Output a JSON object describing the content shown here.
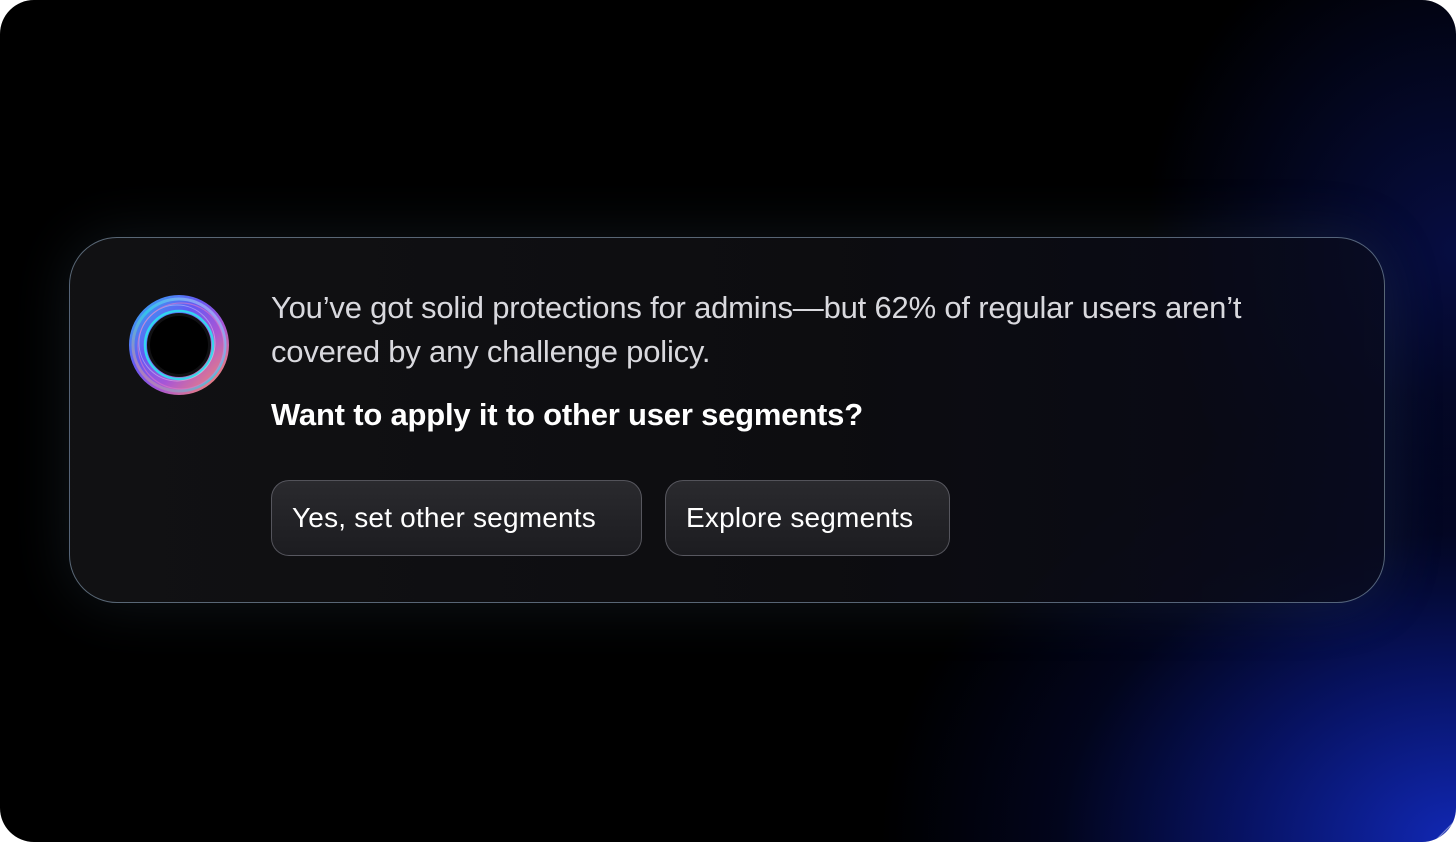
{
  "prompt": {
    "message": "You’ve got solid protections for admins—but 62% of regular users aren’t covered by any challenge policy.",
    "question": "Want to apply it to other user segments?"
  },
  "actions": {
    "primary_label": "Yes, set other segments",
    "secondary_label": "Explore segments"
  },
  "icons": {
    "assistant": "assistant-orb-icon"
  },
  "colors": {
    "background": "#000000",
    "glow": "#1228be",
    "card_border": "#96afc8",
    "button_bg": "#242428",
    "text_primary": "#ffffff",
    "text_secondary": "#d9d9de"
  }
}
